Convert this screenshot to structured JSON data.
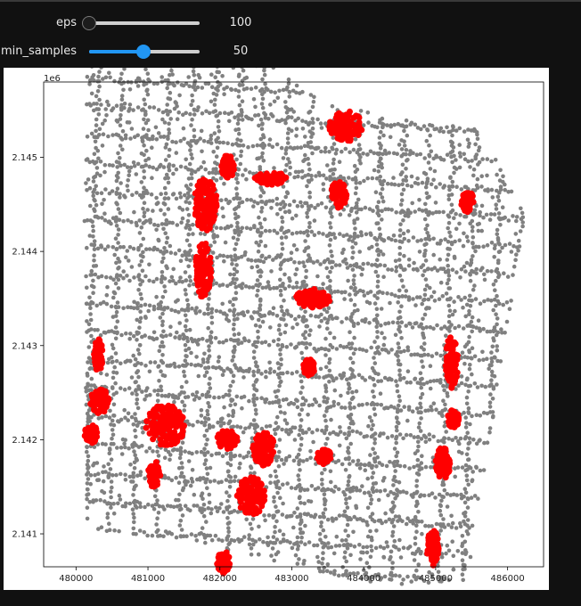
{
  "controls": {
    "eps": {
      "label": "eps",
      "value": "100",
      "min": 100,
      "max": 1000,
      "current": 100
    },
    "min_samples": {
      "label": "min_samples",
      "value": "50",
      "min": 1,
      "max": 100,
      "current": 50
    }
  },
  "colors": {
    "noise": "#808080",
    "cluster": "#ff0000",
    "background": "#111111",
    "slider_accent": "#2196f3"
  },
  "chart_data": {
    "type": "scatter",
    "title": "",
    "xlabel": "",
    "ylabel": "",
    "xlim": [
      479550,
      486500
    ],
    "ylim": [
      2140650,
      2145800
    ],
    "y_offset_label": "1e6",
    "x_ticks": [
      480000,
      481000,
      482000,
      483000,
      484000,
      485000,
      486000
    ],
    "x_tick_labels": [
      "480000",
      "481000",
      "482000",
      "483000",
      "484000",
      "485000",
      "486000"
    ],
    "y_ticks": [
      2141000,
      2142000,
      2143000,
      2144000,
      2145000
    ],
    "y_tick_labels": [
      "2.141",
      "2.142",
      "2.143",
      "2.144",
      "2.145"
    ],
    "grid": false,
    "noise_region": [
      [
        480100,
        2146250
      ],
      [
        482000,
        2146350
      ],
      [
        483500,
        2145550
      ],
      [
        485600,
        2145300
      ],
      [
        486250,
        2144450
      ],
      [
        485450,
        2140500
      ],
      [
        484250,
        2140450
      ],
      [
        481300,
        2140950
      ],
      [
        480150,
        2141050
      ]
    ],
    "series": [
      {
        "role": "cluster",
        "clusters": [
          {
            "x": 483750,
            "y": 2145330,
            "rx": 230,
            "ry": 160
          },
          {
            "x": 482110,
            "y": 2144900,
            "rx": 90,
            "ry": 130
          },
          {
            "x": 482700,
            "y": 2144780,
            "rx": 220,
            "ry": 70
          },
          {
            "x": 483650,
            "y": 2144600,
            "rx": 110,
            "ry": 140
          },
          {
            "x": 485440,
            "y": 2144530,
            "rx": 90,
            "ry": 110
          },
          {
            "x": 481800,
            "y": 2144500,
            "rx": 160,
            "ry": 280
          },
          {
            "x": 481770,
            "y": 2143800,
            "rx": 110,
            "ry": 300
          },
          {
            "x": 483290,
            "y": 2143500,
            "rx": 240,
            "ry": 100
          },
          {
            "x": 480310,
            "y": 2142900,
            "rx": 60,
            "ry": 170
          },
          {
            "x": 485220,
            "y": 2142820,
            "rx": 90,
            "ry": 270
          },
          {
            "x": 483240,
            "y": 2142770,
            "rx": 80,
            "ry": 90
          },
          {
            "x": 480330,
            "y": 2142410,
            "rx": 130,
            "ry": 130
          },
          {
            "x": 485240,
            "y": 2142220,
            "rx": 80,
            "ry": 100
          },
          {
            "x": 481240,
            "y": 2142150,
            "rx": 270,
            "ry": 220
          },
          {
            "x": 480210,
            "y": 2142060,
            "rx": 90,
            "ry": 100
          },
          {
            "x": 482100,
            "y": 2142000,
            "rx": 140,
            "ry": 100
          },
          {
            "x": 482610,
            "y": 2141900,
            "rx": 150,
            "ry": 180
          },
          {
            "x": 483450,
            "y": 2141820,
            "rx": 100,
            "ry": 80
          },
          {
            "x": 481090,
            "y": 2141630,
            "rx": 90,
            "ry": 140
          },
          {
            "x": 485100,
            "y": 2141750,
            "rx": 100,
            "ry": 170
          },
          {
            "x": 482440,
            "y": 2141400,
            "rx": 200,
            "ry": 200
          },
          {
            "x": 484960,
            "y": 2140850,
            "rx": 80,
            "ry": 200
          },
          {
            "x": 482050,
            "y": 2140700,
            "rx": 90,
            "ry": 120
          }
        ]
      }
    ]
  }
}
